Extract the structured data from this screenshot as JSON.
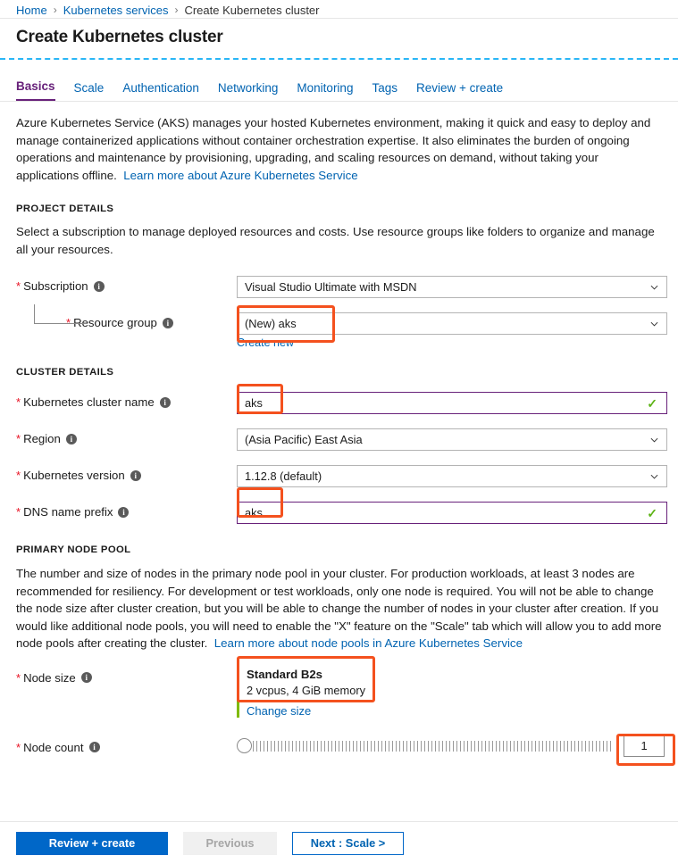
{
  "breadcrumb": {
    "home": "Home",
    "service": "Kubernetes services",
    "current": "Create Kubernetes cluster",
    "separator": "›"
  },
  "page": {
    "title": "Create Kubernetes cluster"
  },
  "tabs": [
    {
      "label": "Basics",
      "active": true
    },
    {
      "label": "Scale",
      "active": false
    },
    {
      "label": "Authentication",
      "active": false
    },
    {
      "label": "Networking",
      "active": false
    },
    {
      "label": "Monitoring",
      "active": false
    },
    {
      "label": "Tags",
      "active": false
    },
    {
      "label": "Review + create",
      "active": false
    }
  ],
  "intro": {
    "text": "Azure Kubernetes Service (AKS) manages your hosted Kubernetes environment, making it quick and easy to deploy and manage containerized applications without container orchestration expertise. It also eliminates the burden of ongoing operations and maintenance by provisioning, upgrading, and scaling resources on demand, without taking your applications offline.",
    "link": "Learn more about Azure Kubernetes Service"
  },
  "project_details": {
    "heading": "PROJECT DETAILS",
    "description": "Select a subscription to manage deployed resources and costs. Use resource groups like folders to organize and manage all your resources.",
    "subscription": {
      "label": "Subscription",
      "value": "Visual Studio Ultimate with MSDN",
      "required": "*",
      "info": "i"
    },
    "resource_group": {
      "label": "Resource group",
      "value": "(New) aks",
      "create_new": "Create new",
      "required": "*",
      "info": "i"
    }
  },
  "cluster_details": {
    "heading": "CLUSTER DETAILS",
    "cluster_name": {
      "label": "Kubernetes cluster name",
      "value": "aks",
      "required": "*",
      "info": "i",
      "valid": true
    },
    "region": {
      "label": "Region",
      "value": "(Asia Pacific) East Asia",
      "required": "*",
      "info": "i"
    },
    "kubernetes_version": {
      "label": "Kubernetes version",
      "value": "1.12.8 (default)",
      "required": "*",
      "info": "i"
    },
    "dns_name_prefix": {
      "label": "DNS name prefix",
      "value": "aks",
      "required": "*",
      "info": "i",
      "valid": true
    }
  },
  "primary_node_pool": {
    "heading": "PRIMARY NODE POOL",
    "description": "The number and size of nodes in the primary node pool in your cluster. For production workloads, at least 3 nodes are recommended for resiliency. For development or test workloads, only one node is required. You will not be able to change the node size after cluster creation, but you will be able to change the number of nodes in your cluster after creation. If you would like additional node pools, you will need to enable the \"X\" feature on the \"Scale\" tab which will allow you to add more node pools after creating the cluster.",
    "link": "Learn more about node pools in Azure Kubernetes Service",
    "node_size": {
      "label": "Node size",
      "required": "*",
      "info": "i",
      "name": "Standard B2s",
      "specs": "2 vcpus, 4 GiB memory",
      "change_link": "Change size"
    },
    "node_count": {
      "label": "Node count",
      "required": "*",
      "info": "i",
      "value": "1"
    }
  },
  "footer": {
    "review_create": "Review + create",
    "previous": "Previous",
    "next": "Next : Scale >"
  },
  "colors": {
    "accent_blue": "#0067c8",
    "link_blue": "#0063b1",
    "active_tab_purple": "#68217a",
    "highlight_red": "#f4511e",
    "valid_green": "#5eb417",
    "node_bar_green": "#7fba00",
    "dashed_cyan": "#29b6f6",
    "required_red": "#e81123"
  },
  "icons": {
    "chevron_down": "chevron-down-icon",
    "info": "info-icon",
    "check": "✓"
  }
}
